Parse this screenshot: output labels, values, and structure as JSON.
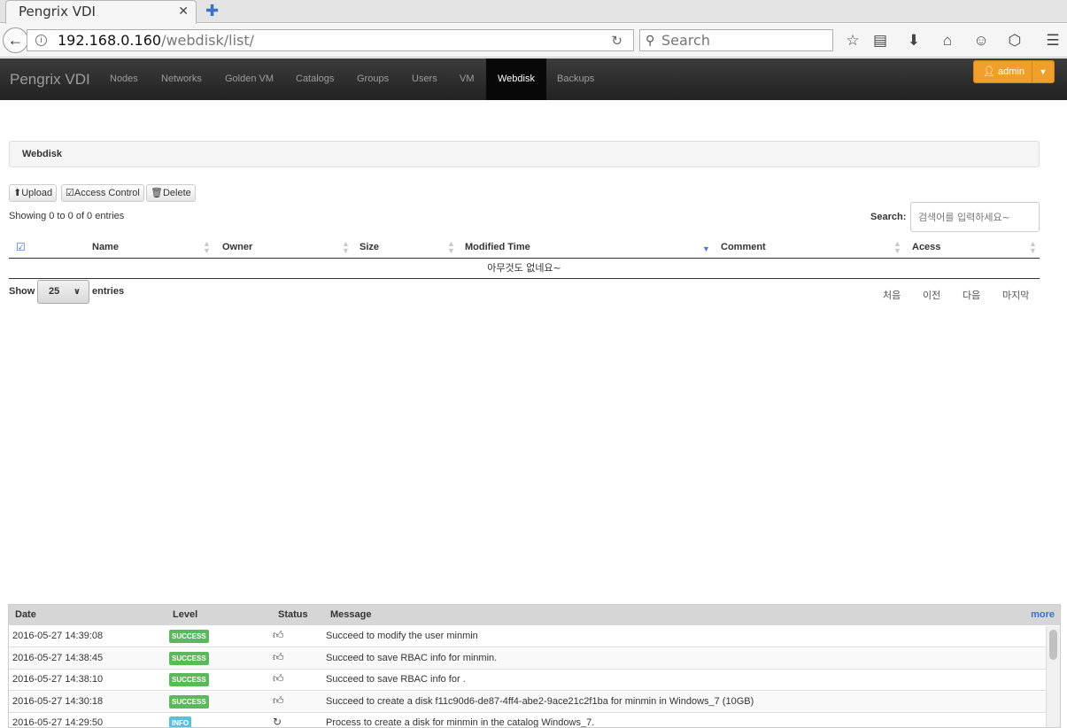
{
  "browser": {
    "tab_title": "Pengrix VDI",
    "tab_close": "✕",
    "new_tab": "✚",
    "url_host": "192.168.0.160",
    "url_path": "/webdisk/list/",
    "search_placeholder": "Search"
  },
  "app": {
    "brand": "Pengrix VDI",
    "nav": [
      {
        "label": "Nodes"
      },
      {
        "label": "Networks"
      },
      {
        "label": "Golden VM"
      },
      {
        "label": "Catalogs"
      },
      {
        "label": "Groups"
      },
      {
        "label": "Users"
      },
      {
        "label": "VM"
      },
      {
        "label": "Webdisk"
      },
      {
        "label": "Backups"
      }
    ],
    "active_nav": "Webdisk",
    "user": "admin",
    "accent_color": "#f0a02a"
  },
  "page": {
    "panel_title": "Webdisk",
    "toolbar": {
      "upload": "Upload",
      "access_control": "Access Control",
      "delete": "Delete"
    },
    "showing": "Showing 0 to 0 of 0 entries",
    "search_label": "Search:",
    "search_placeholder": "검색어를 입력하세요~",
    "columns": [
      "Name",
      "Owner",
      "Size",
      "Modified Time",
      "Comment",
      "Acess"
    ],
    "empty_text": "아무것도 없네요~",
    "show_label": "Show",
    "page_size": "25",
    "entries_label": "entries",
    "pagination": [
      "처음",
      "이전",
      "다음",
      "마지막"
    ]
  },
  "log": {
    "headers": {
      "date": "Date",
      "level": "Level",
      "status": "Status",
      "message": "Message"
    },
    "more": "more",
    "rows": [
      {
        "date": "2016-05-27 14:39:08",
        "level": "SUCCESS",
        "level_color": "#5cb85c",
        "status_icon": "thumbs-up-icon",
        "message": "Succeed to modify the user minmin"
      },
      {
        "date": "2016-05-27 14:38:45",
        "level": "SUCCESS",
        "level_color": "#5cb85c",
        "status_icon": "thumbs-up-icon",
        "message": "Succeed to save RBAC info for minmin."
      },
      {
        "date": "2016-05-27 14:38:10",
        "level": "SUCCESS",
        "level_color": "#5cb85c",
        "status_icon": "thumbs-up-icon",
        "message": "Succeed to save RBAC info for ."
      },
      {
        "date": "2016-05-27 14:30:18",
        "level": "SUCCESS",
        "level_color": "#5cb85c",
        "status_icon": "thumbs-up-icon",
        "message": "Succeed to create a disk f11c90d6-de87-4ff4-abe2-9ace21c2f1ba for minmin in Windows_7 (10GB)"
      },
      {
        "date": "2016-05-27 14:29:50",
        "level": "INFO",
        "level_color": "#5bc0de",
        "status_icon": "refresh-icon",
        "message": "Process to create a disk for minmin in the catalog Windows_7."
      }
    ]
  }
}
